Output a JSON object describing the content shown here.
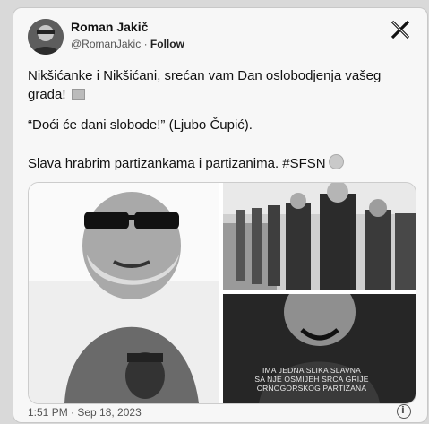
{
  "author": {
    "name": "Roman Jakič",
    "handle": "@RomanJakic",
    "follow": "Follow"
  },
  "post": {
    "line1": "Nikšićanke i Nikšićani, srećan vam Dan oslobodjenja vašeg grada!",
    "line2": "“Doći će dani slobode!” (Ljubo Čupić).",
    "line3": "Slava hrabrim partizankama i partizanima. #SFSN"
  },
  "media": {
    "caption": [
      "IMA JEDNA SLIKA SLAVNA",
      "SA NJE OSMIJEH SRCA GRIJE",
      "CRNOGORSKOG PARTIZANA"
    ]
  },
  "timestamp": "1:51 PM · Sep 18, 2023",
  "icons": {
    "platform": "x-logo-icon",
    "info": "info-icon"
  }
}
